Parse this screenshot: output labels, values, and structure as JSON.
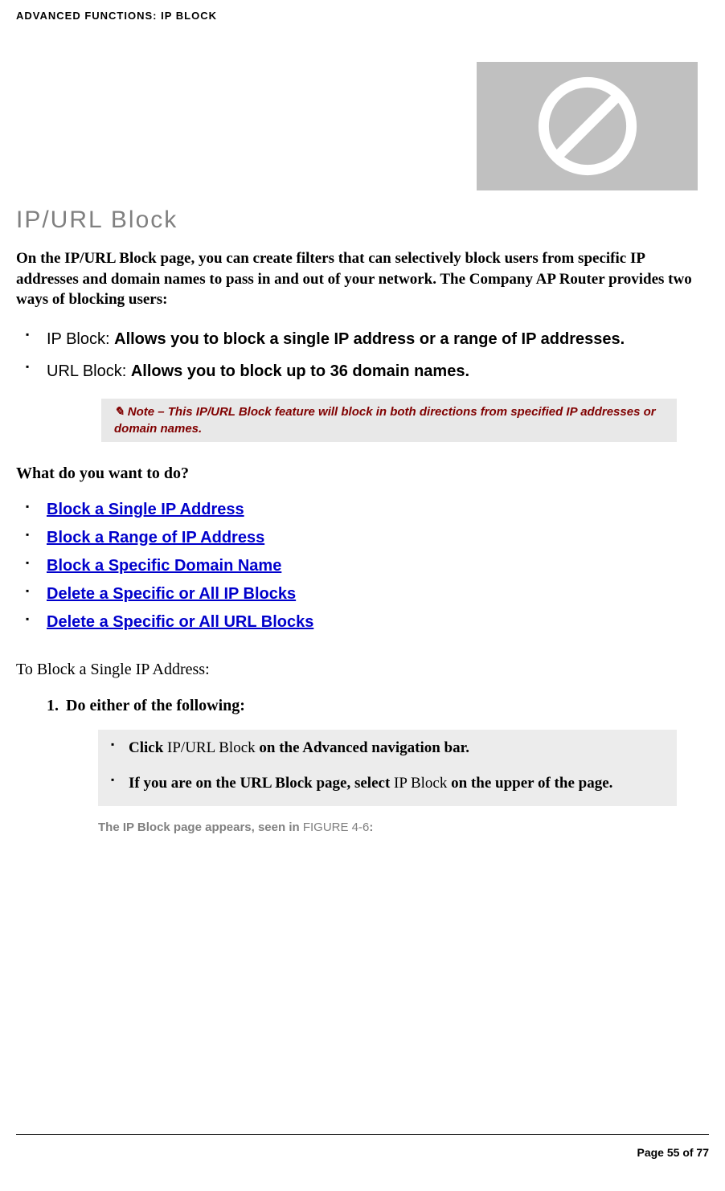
{
  "header": {
    "breadcrumb": "ADVANCED FUNCTIONS: IP BLOCK"
  },
  "title": "IP/URL Block",
  "intro": "On the IP/URL Block page, you can create filters that can selectively block users from specific IP addresses and domain names to pass in and out of your network. The Company AP Router provides two ways of blocking users:",
  "bullets": {
    "ip_label": "IP Block: ",
    "ip_text": "Allows you to block a single IP address or a range of IP addresses.",
    "url_label": "URL Block: ",
    "url_text": "Allows you to block up to 36 domain names."
  },
  "note": {
    "label": "Note",
    "text": " – This IP/URL Block feature will block in both directions from specified IP addresses or domain names."
  },
  "question": "What do you want to do?",
  "links": [
    "Block a Single IP Address",
    "Block a Range of IP Address",
    "Block a Specific Domain Name",
    "Delete a Specific or All IP Blocks",
    "Delete a Specific or All URL Blocks"
  ],
  "section_title": "To Block a Single IP Address:",
  "step1_num": "1.",
  "step1_text": "Do either of the following:",
  "sub_items": {
    "item1_bold1": "Click ",
    "item1_plain": "IP/URL Block",
    "item1_bold2": " on the Advanced navigation bar.",
    "item2_bold1": "If you are on the URL Block page, select ",
    "item2_plain": "IP Block",
    "item2_bold2": " on the upper of the page."
  },
  "caption": {
    "text1": "The IP Block page appears, seen in ",
    "figure": "FIGURE 4-6",
    "text2": ":"
  },
  "footer": {
    "page": "Page 55 of 77"
  }
}
